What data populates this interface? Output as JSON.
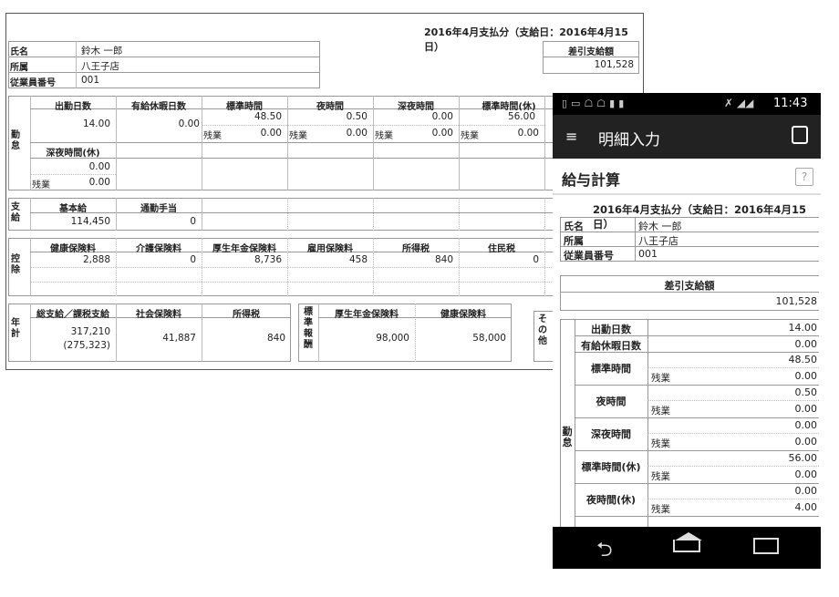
{
  "desktop": {
    "pay_period": "2016年4月支払分（支給日：2016年4月15日）",
    "employee": {
      "name_label": "氏名",
      "name_value": "鈴木 一郎",
      "dept_label": "所属",
      "dept_value": "八王子店",
      "id_label": "従業員番号",
      "id_value": "001"
    },
    "net_pay": {
      "label": "差引支給額",
      "value": "101,528"
    },
    "attendance": {
      "section_label": "勤怠",
      "headers": [
        "出勤日数",
        "有給休暇日数",
        "標準時間",
        "夜時間",
        "深夜時間",
        "標準時間(休)"
      ],
      "values": [
        "14.00",
        "0.00",
        "48.50",
        "0.50",
        "0.00",
        "56.00"
      ],
      "overtime_label": "残業",
      "overtime_values": [
        "0.00",
        "0.00",
        "0.00",
        "0.00"
      ],
      "row2_header": "深夜時間(休)",
      "row2_value": "0.00",
      "row2_overtime": "0.00"
    },
    "payment": {
      "section_label": "支給",
      "headers": [
        "基本給",
        "通勤手当"
      ],
      "values": [
        "114,450",
        "0"
      ]
    },
    "deduction": {
      "section_label": "控除",
      "headers": [
        "健康保険料",
        "介護保険料",
        "厚生年金保険料",
        "雇用保険料",
        "所得税",
        "住民税"
      ],
      "values": [
        "2,888",
        "0",
        "8,736",
        "458",
        "840",
        "0"
      ]
    },
    "annual": {
      "section_label": "年計",
      "headers": [
        "総支給／課税支給",
        "社会保険料",
        "所得税"
      ],
      "total": "317,210",
      "taxable": "(275,323)",
      "social": "41,887",
      "tax": "840",
      "std_label": "標準報酬",
      "std_headers": [
        "厚生年金保険料",
        "健康保険料"
      ],
      "std_values": [
        "98,000",
        "58,000"
      ],
      "other_label": "その他"
    }
  },
  "phone": {
    "time": "11:43",
    "app_title": "明細入力",
    "section_title": "給与計算",
    "help": "?",
    "pay_period": "2016年4月支払分（支給日：2016年4月15日）",
    "name_label": "氏名",
    "name_value": "鈴木 一郎",
    "dept_label": "所属",
    "dept_value": "八王子店",
    "id_label": "従業員番号",
    "id_value": "001",
    "net_label": "差引支給額",
    "net_value": "101,528",
    "attendance_label": "勤怠",
    "days_label": "出勤日数",
    "days_value": "14.00",
    "paid_label": "有給休暇日数",
    "paid_value": "0.00",
    "overtime_label": "残業",
    "rows": [
      {
        "label": "標準時間",
        "value": "48.50",
        "ot": "0.00"
      },
      {
        "label": "夜時間",
        "value": "0.50",
        "ot": "0.00"
      },
      {
        "label": "深夜時間",
        "value": "0.00",
        "ot": "0.00"
      },
      {
        "label": "標準時間(休)",
        "value": "56.00",
        "ot": "0.00"
      },
      {
        "label": "夜時間(休)",
        "value": "0.00",
        "ot": "4.00"
      }
    ]
  }
}
